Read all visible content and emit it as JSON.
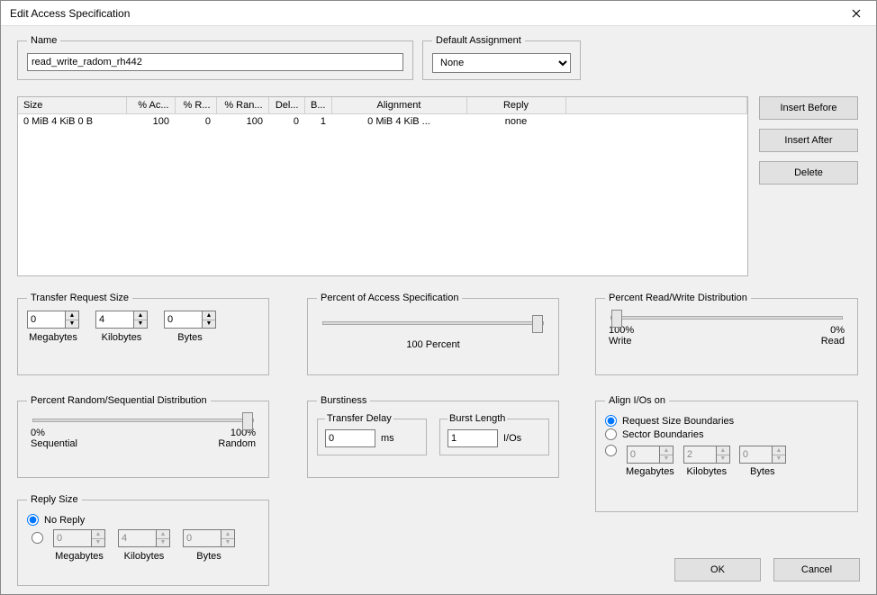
{
  "window": {
    "title": "Edit Access Specification"
  },
  "name": {
    "legend": "Name",
    "value": "read_write_radom_rh442"
  },
  "defaultAssignment": {
    "legend": "Default Assignment",
    "value": "None"
  },
  "table": {
    "headers": [
      "Size",
      "% Ac...",
      "% R...",
      "% Ran...",
      "Del...",
      "B...",
      "Alignment",
      "Reply"
    ],
    "row": {
      "size": "0 MiB   4 KiB   0 B",
      "access": "100",
      "read": "0",
      "random": "100",
      "delay": "0",
      "burst": "1",
      "alignment": "0 MiB   4 KiB   ...",
      "reply": "none"
    }
  },
  "buttons": {
    "insertBefore": "Insert Before",
    "insertAfter": "Insert After",
    "delete": "Delete",
    "ok": "OK",
    "cancel": "Cancel"
  },
  "trs": {
    "legend": "Transfer Request Size",
    "mb": "0",
    "kb": "4",
    "b": "0",
    "mbLabel": "Megabytes",
    "kbLabel": "Kilobytes",
    "bLabel": "Bytes"
  },
  "pas": {
    "legend": "Percent of Access Specification",
    "caption": "100 Percent"
  },
  "prw": {
    "legend": "Percent Read/Write Distribution",
    "leftTop": "100%",
    "leftBottom": "Write",
    "rightTop": "0%",
    "rightBottom": "Read"
  },
  "prs": {
    "legend": "Percent Random/Sequential Distribution",
    "leftTop": "0%",
    "leftBottom": "Sequential",
    "rightTop": "100%",
    "rightBottom": "Random"
  },
  "burst": {
    "legend": "Burstiness",
    "delayLegend": "Transfer Delay",
    "delayValue": "0",
    "delayUnit": "ms",
    "lengthLegend": "Burst Length",
    "lengthValue": "1",
    "lengthUnit": "I/Os"
  },
  "align": {
    "legend": "Align I/Os on",
    "opt1": "Request Size Boundaries",
    "opt2": "Sector Boundaries",
    "mb": "0",
    "kb": "2",
    "b": "0",
    "mbLabel": "Megabytes",
    "kbLabel": "Kilobytes",
    "bLabel": "Bytes"
  },
  "reply": {
    "legend": "Reply Size",
    "noReply": "No Reply",
    "mb": "0",
    "kb": "4",
    "b": "0",
    "mbLabel": "Megabytes",
    "kbLabel": "Kilobytes",
    "bLabel": "Bytes"
  }
}
